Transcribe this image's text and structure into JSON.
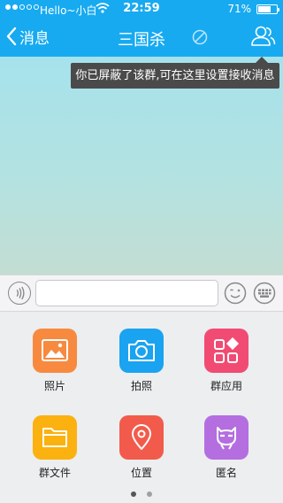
{
  "status_bar": {
    "carrier": "Hello~小白",
    "time": "22:59",
    "battery_percent": "71%",
    "battery_level": 0.71,
    "signal_bars_filled": 2,
    "signal_bars_total": 5
  },
  "nav": {
    "back_label": "消息",
    "title": "三国杀",
    "mute_icon": "mute-icon",
    "group_icon": "group-members-icon"
  },
  "tooltip": {
    "text": "你已屏蔽了该群,可在这里设置接收消息"
  },
  "input_bar": {
    "text_value": "",
    "voice_icon": "voice-icon",
    "emoji_icon": "emoji-icon",
    "more_icon": "keyboard-icon"
  },
  "panel": {
    "items": [
      {
        "label": "照片",
        "icon": "photo-icon",
        "color": "#f78a3f"
      },
      {
        "label": "拍照",
        "icon": "camera-icon",
        "color": "#1aa3f0"
      },
      {
        "label": "群应用",
        "icon": "apps-icon",
        "color": "#f14b74"
      },
      {
        "label": "群文件",
        "icon": "folder-icon",
        "color": "#fbb10f"
      },
      {
        "label": "位置",
        "icon": "location-icon",
        "color": "#f25b4b"
      },
      {
        "label": "匿名",
        "icon": "anonymous-icon",
        "color": "#b46ee0"
      }
    ],
    "pages": 2,
    "current_page": 1
  },
  "colors": {
    "nav_background": "#17aaf0",
    "tooltip_background": "#4a4a4a"
  }
}
